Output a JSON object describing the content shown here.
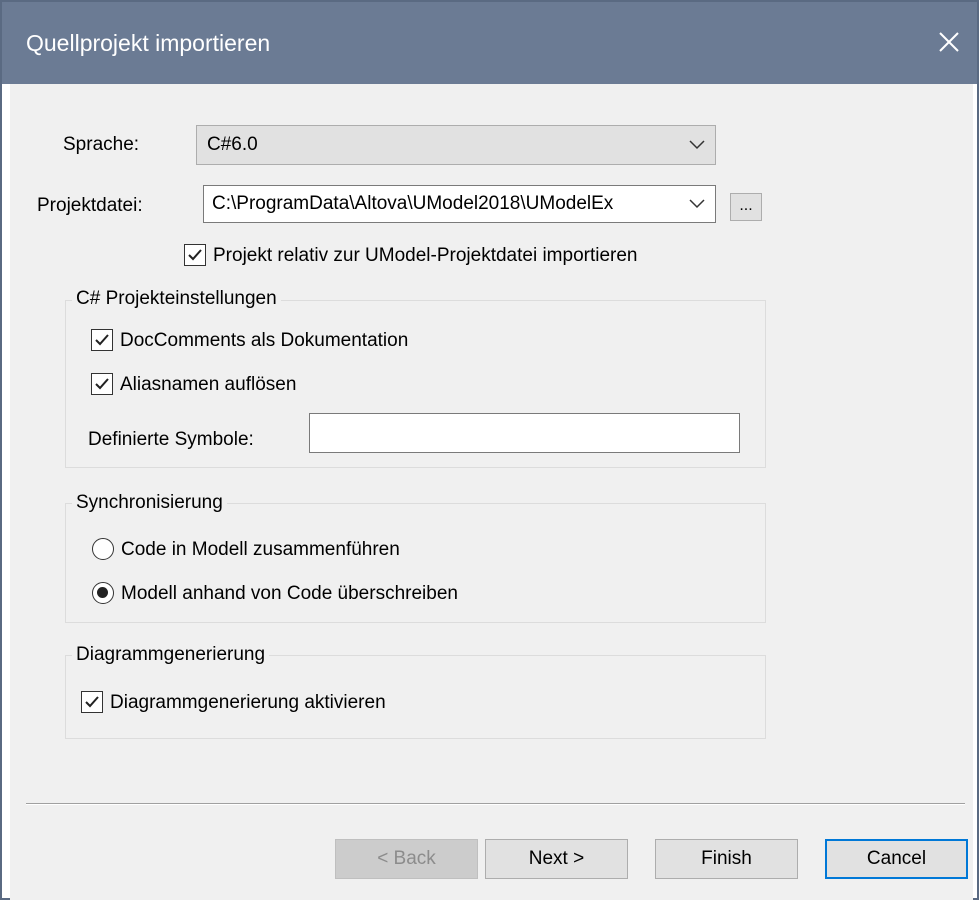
{
  "window": {
    "title": "Quellprojekt importieren"
  },
  "form": {
    "language_label": "Sprache:",
    "language_value": "C#6.0",
    "projectfile_label": "Projektdatei:",
    "projectfile_value": "C:\\ProgramData\\Altova\\UModel2018\\UModelEx",
    "browse_label": "...",
    "relative_import": {
      "label": "Projekt relativ zur UModel-Projektdatei importieren",
      "checked": true
    }
  },
  "csharp_settings": {
    "title": "C# Projekteinstellungen",
    "doccomments": {
      "label": "DocComments als Dokumentation",
      "checked": true
    },
    "resolve_aliases": {
      "label": "Aliasnamen auflösen",
      "checked": true
    },
    "defined_symbols_label": "Definierte Symbole:",
    "defined_symbols_value": ""
  },
  "sync": {
    "title": "Synchronisierung",
    "options": [
      {
        "label": "Code in Modell zusammenführen",
        "selected": false
      },
      {
        "label": "Modell anhand von Code überschreiben",
        "selected": true
      }
    ]
  },
  "diagram": {
    "title": "Diagrammgenerierung",
    "enable": {
      "label": "Diagrammgenerierung aktivieren",
      "checked": true
    }
  },
  "buttons": {
    "back": "< Back",
    "next": "Next >",
    "finish": "Finish",
    "cancel": "Cancel"
  }
}
